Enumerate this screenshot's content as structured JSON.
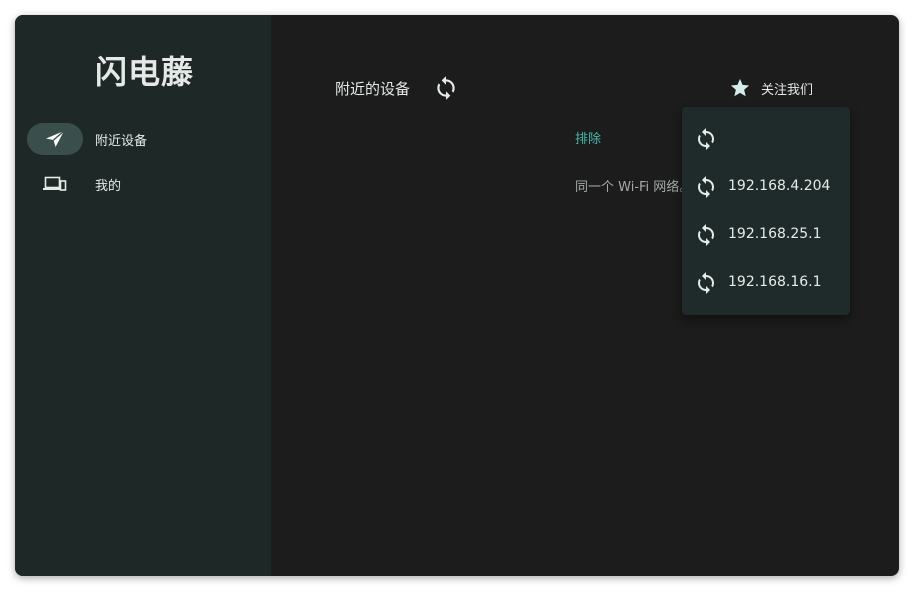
{
  "app": {
    "title": "闪电藤"
  },
  "sidebar": {
    "items": [
      {
        "label": "附近设备",
        "icon": "send-icon",
        "active": true
      },
      {
        "label": "我的",
        "icon": "devices-icon",
        "active": false
      }
    ]
  },
  "header": {
    "title": "附近的设备",
    "refresh_icon": "refresh-icon",
    "follow_label": "关注我们",
    "follow_icon": "star-icon"
  },
  "background": {
    "link_text": "排除",
    "hint_text": "同一个 Wi-Fi 网络。"
  },
  "dropdown": {
    "items": [
      {
        "label": "",
        "icon": "refresh-icon"
      },
      {
        "label": "192.168.4.204",
        "icon": "refresh-icon"
      },
      {
        "label": "192.168.25.1",
        "icon": "refresh-icon"
      },
      {
        "label": "192.168.16.1",
        "icon": "refresh-icon"
      }
    ]
  },
  "colors": {
    "window_bg": "#1b1c1b",
    "sidebar_bg": "#1e2827",
    "active_pill": "#3a4f4b",
    "accent": "#49b6aa",
    "dropdown_bg": "#1f2b2a",
    "text": "#e4e8e6"
  }
}
